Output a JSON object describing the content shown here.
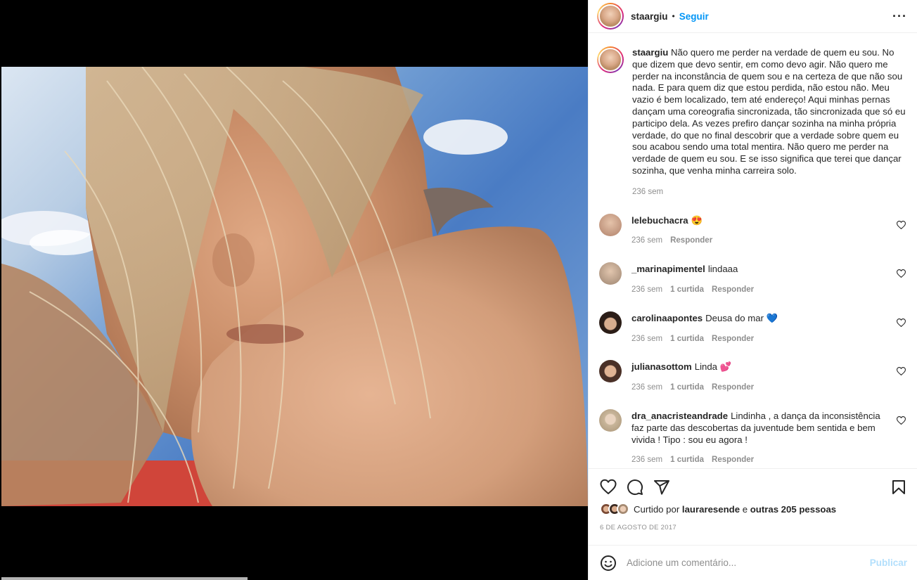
{
  "post": {
    "username": "staargiu",
    "separator": "•",
    "follow_label": "Seguir",
    "more_label": "•••"
  },
  "caption": {
    "username": "staargiu",
    "text": "Não quero me perder na verdade de quem eu sou. No que dizem que devo sentir, em como devo agir. Não quero me perder na inconstância de quem sou e na certeza de que não sou nada. E para quem diz que estou perdida, não estou não. Meu vazio é bem localizado, tem até endereço! Aqui minhas pernas dançam uma coreografia sincronizada, tão sincronizada que só eu participo dela. As vezes prefiro dançar sozinha na minha própria verdade, do que no final descobrir que a verdade sobre quem eu sou acabou sendo uma total mentira. Não quero me perder na verdade de quem eu sou. E se isso significa que terei que dançar sozinha, que venha minha carreira solo.",
    "time": "236 sem"
  },
  "comments": [
    {
      "username": "lelebuchacra",
      "text": "😍",
      "time": "236 sem",
      "likes": "",
      "reply": "Responder",
      "avatar_color": "#c9a48c"
    },
    {
      "username": "_marinapimentel",
      "text": "lindaaa",
      "time": "236 sem",
      "likes": "1 curtida",
      "reply": "Responder",
      "avatar_color": "#b59b84"
    },
    {
      "username": "carolinaapontes",
      "text": "Deusa do mar 💙",
      "time": "236 sem",
      "likes": "1 curtida",
      "reply": "Responder",
      "avatar_color": "#3b2a22"
    },
    {
      "username": "julianasottom",
      "text": "Linda 💕",
      "time": "236 sem",
      "likes": "1 curtida",
      "reply": "Responder",
      "avatar_color": "#5a4036"
    },
    {
      "username": "dra_anacristeandrade",
      "text": "Lindinha , a dança da inconsistência faz parte das descobertas da juventude bem sentida e bem vivida ! Tipo : sou eu agora !",
      "time": "236 sem",
      "likes": "1 curtida",
      "reply": "Responder",
      "avatar_color": "#c8b59a"
    }
  ],
  "likes": {
    "prefix": "Curtido por",
    "user": "lauraresende",
    "connector": "e",
    "others": "outras 205 pessoas"
  },
  "date": "6 DE AGOSTO DE 2017",
  "add_comment": {
    "placeholder": "Adicione um comentário...",
    "publish_label": "Publicar"
  },
  "icons": {
    "like": "heart-icon",
    "comment": "comment-icon",
    "share": "share-icon",
    "save": "bookmark-icon",
    "emoji": "emoji-icon"
  },
  "colors": {
    "accent": "#0095f6",
    "muted": "#8e8e8e",
    "publish_disabled": "#b2dffc"
  }
}
